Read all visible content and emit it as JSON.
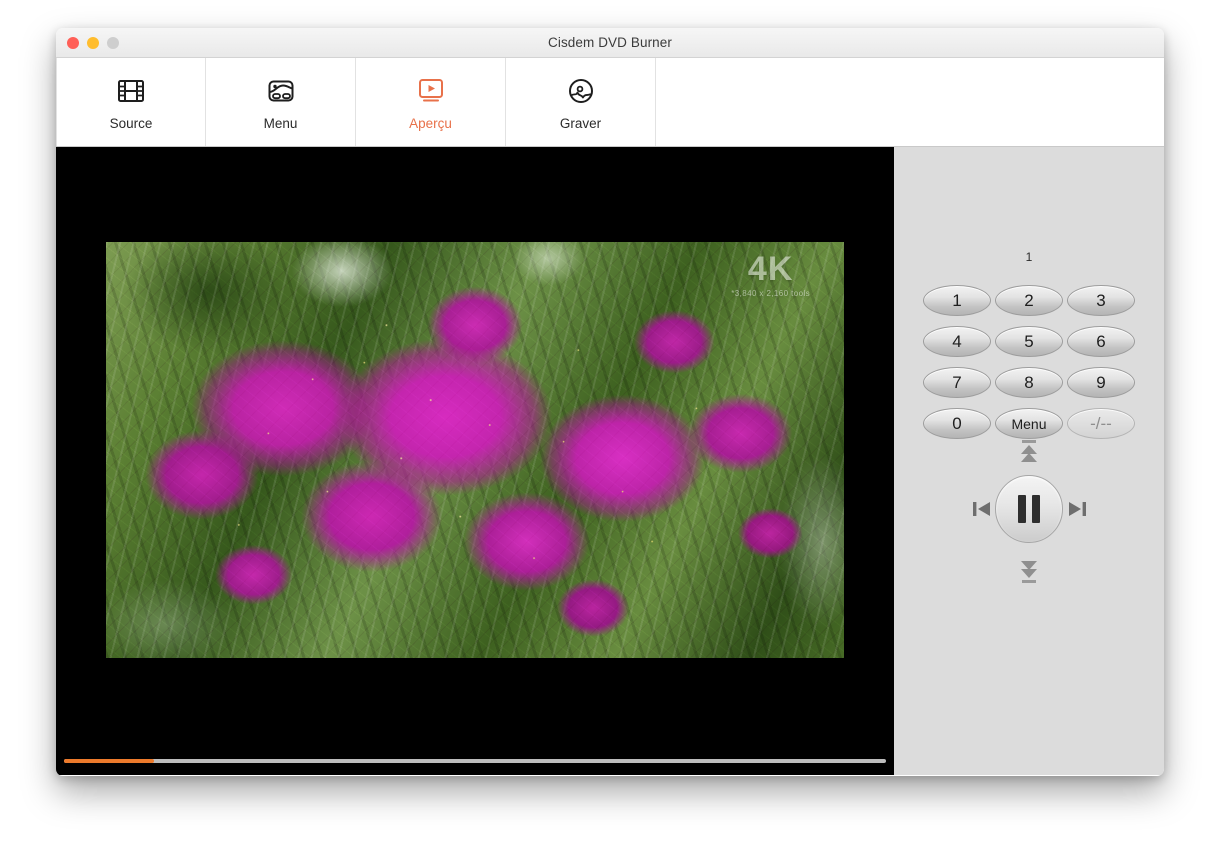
{
  "window": {
    "title": "Cisdem DVD Burner",
    "traffic_lights": [
      {
        "name": "close",
        "color": "#ff5f57"
      },
      {
        "name": "minimize",
        "color": "#ffbd2e"
      },
      {
        "name": "zoom",
        "color": "#cecece"
      }
    ]
  },
  "toolbar": {
    "items": [
      {
        "label": "Source",
        "icon": "film-strip-icon",
        "active": false
      },
      {
        "label": "Menu",
        "icon": "dvd-menu-icon",
        "active": false
      },
      {
        "label": "Aperçu",
        "icon": "preview-play-icon",
        "active": true
      },
      {
        "label": "Graver",
        "icon": "burn-disc-icon",
        "active": false
      }
    ],
    "active_color": "#e8714a",
    "inactive_color": "#2b2b2b"
  },
  "preview": {
    "watermark_big": "4K",
    "watermark_small": "*3,840 x 2,160  tools",
    "progress_percent": 11,
    "progress_fill_color": "#ec7a2b",
    "progress_track_color": "#bcbcbc"
  },
  "remote": {
    "channel_readout": "1",
    "keypad": [
      {
        "label": "1",
        "name": "key-1",
        "disabled": false
      },
      {
        "label": "2",
        "name": "key-2",
        "disabled": false
      },
      {
        "label": "3",
        "name": "key-3",
        "disabled": false
      },
      {
        "label": "4",
        "name": "key-4",
        "disabled": false
      },
      {
        "label": "5",
        "name": "key-5",
        "disabled": false
      },
      {
        "label": "6",
        "name": "key-6",
        "disabled": false
      },
      {
        "label": "7",
        "name": "key-7",
        "disabled": false
      },
      {
        "label": "8",
        "name": "key-8",
        "disabled": false
      },
      {
        "label": "9",
        "name": "key-9",
        "disabled": false
      },
      {
        "label": "0",
        "name": "key-0",
        "disabled": false
      },
      {
        "label": "Menu",
        "name": "key-menu",
        "disabled": false
      },
      {
        "label": "-/--",
        "name": "key-dash",
        "disabled": true
      }
    ],
    "transport": {
      "up": "chapter-up-icon",
      "down": "chapter-down-icon",
      "prev": "previous-track-icon",
      "next": "next-track-icon",
      "center": "pause-icon"
    },
    "panel_color": "#dcdcdc"
  }
}
